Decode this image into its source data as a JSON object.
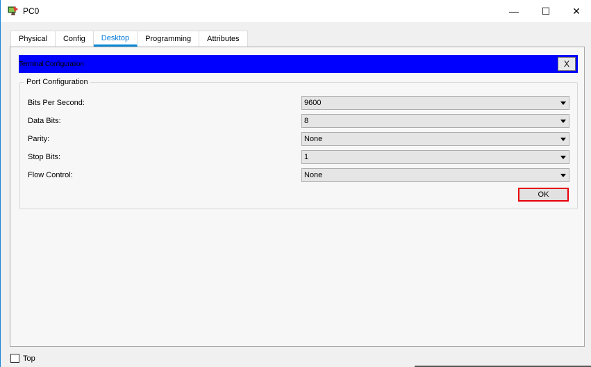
{
  "window": {
    "title": "PC0",
    "minimize_glyph": "—",
    "maximize_glyph": "☐",
    "close_glyph": "✕"
  },
  "tabs": [
    {
      "label": "Physical",
      "active": false
    },
    {
      "label": "Config",
      "active": false
    },
    {
      "label": "Desktop",
      "active": true
    },
    {
      "label": "Programming",
      "active": false
    },
    {
      "label": "Attributes",
      "active": false
    }
  ],
  "terminal": {
    "header_title": "Terminal Configuration",
    "close_label": "X",
    "header_color": "#0000ff",
    "group_title": "Port Configuration",
    "fields": [
      {
        "label": "Bits Per Second:",
        "value": "9600"
      },
      {
        "label": "Data Bits:",
        "value": "8"
      },
      {
        "label": "Parity:",
        "value": "None"
      },
      {
        "label": "Stop Bits:",
        "value": "1"
      },
      {
        "label": "Flow Control:",
        "value": "None"
      }
    ],
    "ok_label": "OK",
    "ok_highlight_color": "#e8000b"
  },
  "footer": {
    "top_checkbox_label": "Top",
    "top_checked": false
  }
}
